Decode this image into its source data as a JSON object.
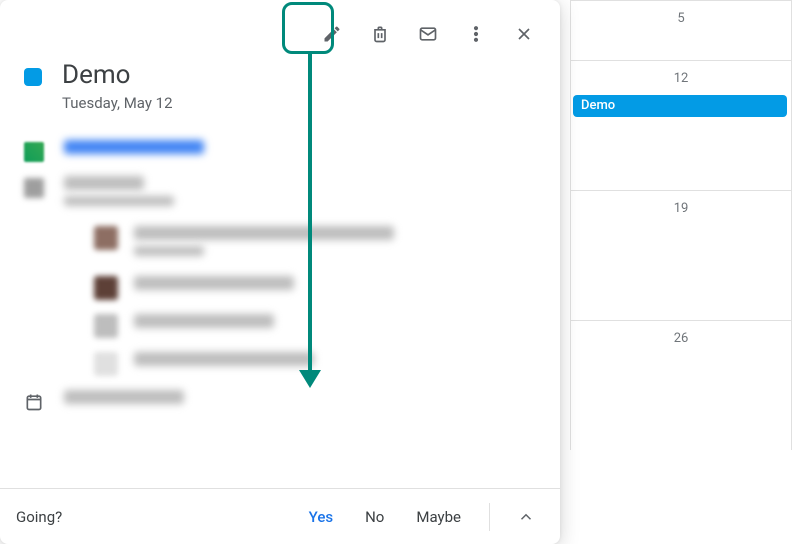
{
  "toolbar": {
    "edit_label": "Edit event",
    "delete_label": "Delete event",
    "email_label": "Email guests",
    "options_label": "Options",
    "close_label": "Close"
  },
  "event": {
    "title": "Demo",
    "date": "Tuesday, May 12",
    "color": "#039be5"
  },
  "rsvp": {
    "prompt": "Going?",
    "yes": "Yes",
    "no": "No",
    "maybe": "Maybe"
  },
  "calendar": {
    "days": [
      "5",
      "12",
      "19",
      "26"
    ],
    "event_label": "Demo"
  },
  "annotation": {
    "target": "edit-button"
  }
}
